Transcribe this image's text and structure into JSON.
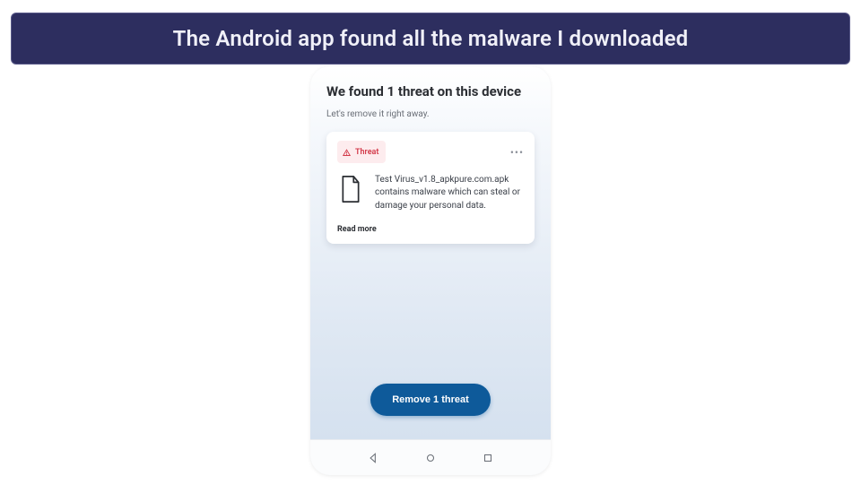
{
  "caption": "The Android app found all the malware I downloaded",
  "screen": {
    "heading": "We found 1 threat on this device",
    "subheading": "Let's remove it right away."
  },
  "threat_card": {
    "badge_label": "Threat",
    "file_name": "Test Virus_v1.8_apkpure.com.apk",
    "description": "contains malware which can steal or damage your personal data.",
    "read_more": "Read more"
  },
  "action_button": "Remove 1 threat",
  "colors": {
    "caption_bg": "#2d2e5f",
    "primary": "#0e5a9a",
    "danger": "#d33a4a"
  }
}
